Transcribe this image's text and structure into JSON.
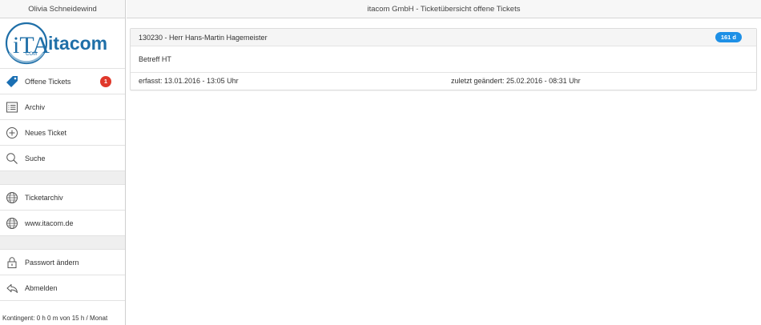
{
  "sidebar": {
    "user_name": "Olivia Schneidewind",
    "logo_text": "itacom",
    "logo_mark": "iTA",
    "logo_mark_sub": "COM",
    "items": [
      {
        "label": "Offene Tickets",
        "icon": "tag-icon",
        "badge": "1"
      },
      {
        "label": "Archiv",
        "icon": "list-icon"
      },
      {
        "label": "Neues Ticket",
        "icon": "plus-circle-icon"
      },
      {
        "label": "Suche",
        "icon": "search-icon"
      },
      {
        "label": "Ticketarchiv",
        "icon": "globe-icon"
      },
      {
        "label": "www.itacom.de",
        "icon": "globe-icon"
      },
      {
        "label": "Passwort ändern",
        "icon": "lock-icon"
      },
      {
        "label": "Abmelden",
        "icon": "reply-icon"
      }
    ],
    "quota": "Kontingent: 0 h 0 m von 15 h / Monat"
  },
  "header": {
    "title": "itacom GmbH - Ticketübersicht offene Tickets"
  },
  "ticket": {
    "title": "130230 - Herr Hans-Martin Hagemeister",
    "age_badge": "161 d",
    "subject": "Betreff HT",
    "created": "erfasst: 13.01.2016 - 13:05 Uhr",
    "modified": "zuletzt geändert: 25.02.2016 - 08:31 Uhr"
  },
  "colors": {
    "logo_blue": "#1f6fa8",
    "badge_red": "#e0382b",
    "badge_blue": "#1e90e6",
    "tag_blue": "#1a6fb3"
  }
}
